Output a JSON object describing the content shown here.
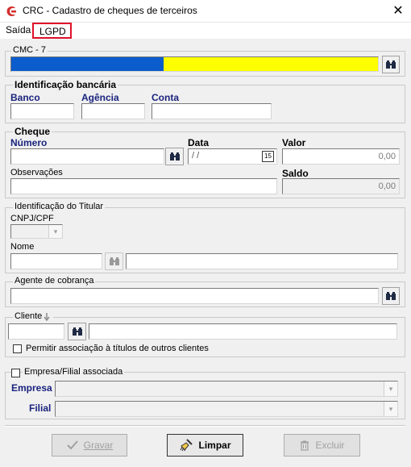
{
  "window": {
    "title": "CRC - Cadastro de cheques de terceiros",
    "close_glyph": "✕",
    "icon": "crc-app-icon"
  },
  "menu": {
    "items": [
      "Saída",
      "LGPD"
    ]
  },
  "cmc": {
    "legend": "CMC - 7",
    "search_icon": "binoculars-icon",
    "bar_color_primary": "#0b5ccc",
    "bar_color_field": "#ffff00"
  },
  "bank": {
    "legend": "Identificação bancária",
    "banco_label": "Banco",
    "agencia_label": "Agência",
    "conta_label": "Conta"
  },
  "cheque": {
    "legend": "Cheque",
    "numero_label": "Número",
    "data_label": "Data",
    "data_value": " / /",
    "valor_label": "Valor",
    "valor_value": "0,00",
    "observacoes_label": "Observações",
    "saldo_label": "Saldo",
    "saldo_value": "0,00",
    "calendar_glyph": "15"
  },
  "titular": {
    "legend": "Identificação do Titular",
    "cnpj_label": "CNPJ/CPF",
    "nome_label": "Nome"
  },
  "agente": {
    "legend": "Agente de cobrança"
  },
  "cliente": {
    "legend": "Cliente",
    "allow_label": "Permitir associação à títulos de outros clientes"
  },
  "empresa": {
    "check_label": "Empresa/Filial associada",
    "empresa_label": "Empresa",
    "filial_label": "Filial"
  },
  "buttons": {
    "gravar": "Gravar",
    "limpar": "Limpar",
    "excluir": "Excluir"
  }
}
